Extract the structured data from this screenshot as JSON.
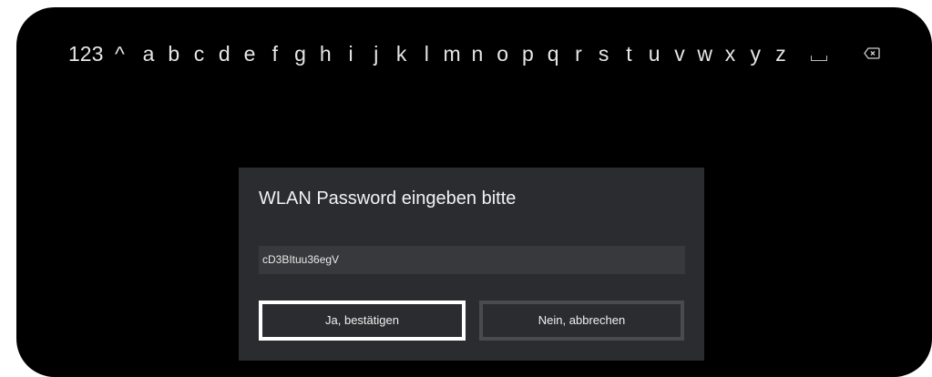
{
  "keyboard": {
    "numbers_key": "123",
    "shift_key": "^",
    "letters": [
      "a",
      "b",
      "c",
      "d",
      "e",
      "f",
      "g",
      "h",
      "i",
      "j",
      "k",
      "l",
      "m",
      "n",
      "o",
      "p",
      "q",
      "r",
      "s",
      "t",
      "u",
      "v",
      "w",
      "x",
      "y",
      "z"
    ]
  },
  "dialog": {
    "title": "WLAN Password eingeben bitte",
    "password_value": "cD3BItuu36egV",
    "confirm_label": "Ja, bestätigen",
    "cancel_label": "Nein, abbrechen"
  }
}
